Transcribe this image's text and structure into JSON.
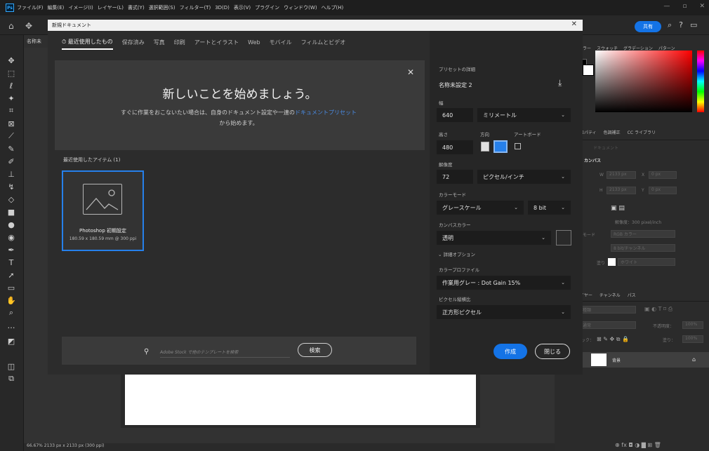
{
  "menubar": {
    "logo": "Ps",
    "items": [
      "ファイル(F)",
      "編集(E)",
      "イメージ(I)",
      "レイヤー(L)",
      "書式(Y)",
      "選択範囲(S)",
      "フィルター(T)",
      "3D(D)",
      "表示(V)",
      "プラグイン",
      "ウィンドウ(W)",
      "ヘルプ(H)"
    ]
  },
  "topbar": {
    "share_label": "共有"
  },
  "doc_tab": "名称未",
  "status": "66.67%    2133 px x 2133 px (300 ppi)",
  "right_panels": {
    "color_tabs": [
      "ラー",
      "スウォッチ",
      "グラデーション",
      "パターン"
    ],
    "props_tabs": [
      "ロパティ",
      "色調補正",
      "CC ライブラリ"
    ],
    "document_label": "ドキュメント",
    "canvas_label": "カンバス",
    "w_label": "W",
    "w_value": "2133 px",
    "x_label": "X",
    "x_value": "0 px",
    "h_label": "H",
    "h_value": "2133 px",
    "y_label": "Y",
    "y_value": "0 px",
    "resolution": "解像度：300 pixel/inch",
    "mode_label": "モード",
    "mode_value": "RGB カラー",
    "bit_value": "8 bit/チャンネル",
    "fill_label": "塗り",
    "fill_value": "ホワイト",
    "layers_tabs": [
      "イヤー",
      "チャンネル",
      "パス"
    ],
    "layer_kind": "種類",
    "layer_blend": "通常",
    "opacity_label": "不透明度：",
    "opacity_value": "100%",
    "lock_label": "ロック：",
    "fill2_label": "塗り：",
    "fill2_value": "100%",
    "layer_name": "背景"
  },
  "dialog": {
    "title": "新規ドキュメント",
    "tabs": [
      "最近使用したもの",
      "保存済み",
      "写真",
      "印刷",
      "アートとイラスト",
      "Web",
      "モバイル",
      "フィルムとビデオ"
    ],
    "hero_title": "新しいことを始めましょう。",
    "hero_desc_1": "すぐに作業をおこないたい場合は、自身のドキュメント設定や一連の",
    "hero_desc_link": "ドキュメントプリセット",
    "hero_desc_2": "から始めます。",
    "recent_label": "最近使用したアイテム (1)",
    "preset_name": "Photoshop 初期設定",
    "preset_size": "180.59 x 180.59 mm @ 300 ppi",
    "stock_placeholder": "Adobe Stock で他のテンプレートを検索",
    "stock_button": "検索",
    "details": {
      "header": "プリセットの詳細",
      "name": "名称未設定 2",
      "width_label": "幅",
      "width_value": "640",
      "unit_value": "ミリメートル",
      "height_label": "高さ",
      "orientation_label": "方向",
      "artboard_label": "アートボード",
      "height_value": "480",
      "resolution_label": "解像度",
      "resolution_value": "72",
      "resolution_unit": "ピクセル/インチ",
      "color_mode_label": "カラーモード",
      "color_mode_value": "グレースケール",
      "bit_depth_value": "8 bit",
      "canvas_color_label": "カンバスカラー",
      "canvas_color_value": "透明",
      "advanced_label": "詳細オプション",
      "profile_label": "カラープロファイル",
      "profile_value": "作業用グレー : Dot Gain 15%",
      "pixel_ratio_label": "ピクセル縦横比",
      "pixel_ratio_value": "正方形ピクセル",
      "create_button": "作成",
      "close_button": "閉じる"
    }
  }
}
